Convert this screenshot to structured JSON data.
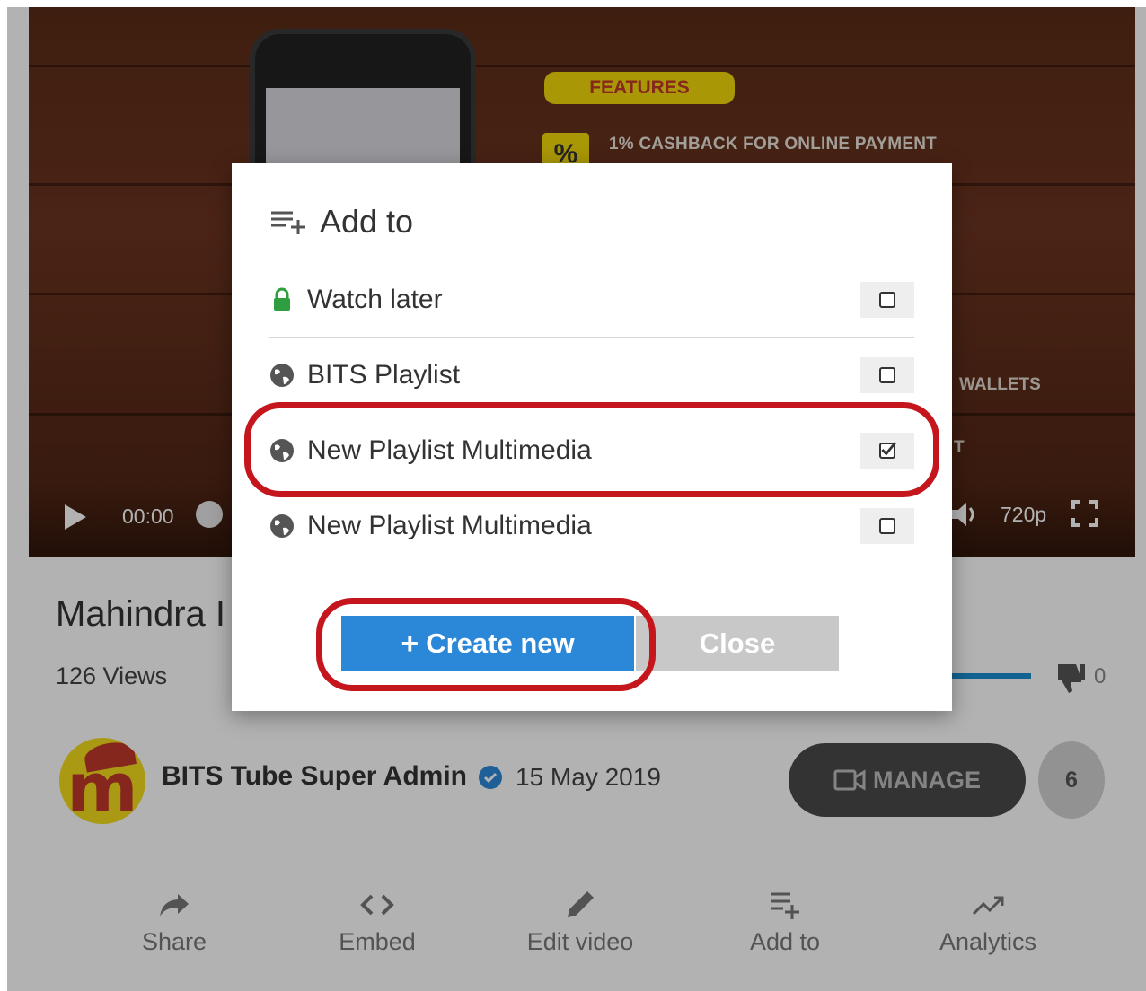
{
  "video": {
    "features_badge": "FEATURES",
    "percent_symbol": "%",
    "cashback_text": "1% CASHBACK FOR ONLINE PAYMENT",
    "wallets_text": "WALLETS",
    "partial_text": "T",
    "time": "00:00",
    "quality": "720p"
  },
  "info": {
    "title": "Mahindra I",
    "views": "126 Views",
    "dislike_count": "0",
    "avatar_letter": "m",
    "channel_name": "BITS Tube Super Admin",
    "upload_date": "15 May 2019",
    "manage_label": "MANAGE",
    "manage_count": "6"
  },
  "actions": [
    {
      "label": "Share",
      "icon": "share-icon"
    },
    {
      "label": "Embed",
      "icon": "embed-icon"
    },
    {
      "label": "Edit video",
      "icon": "pencil-icon"
    },
    {
      "label": "Add to",
      "icon": "playlist-add-icon"
    },
    {
      "label": "Analytics",
      "icon": "trending-up-icon"
    }
  ],
  "modal": {
    "title": "Add to",
    "playlists": [
      {
        "label": "Watch later",
        "icon": "lock-icon",
        "checked": false
      },
      {
        "label": "BITS Playlist",
        "icon": "globe-icon",
        "checked": false
      },
      {
        "label": "New Playlist Multimedia",
        "icon": "globe-icon",
        "checked": true
      },
      {
        "label": "New Playlist Multimedia",
        "icon": "globe-icon",
        "checked": false
      }
    ],
    "create_new_label": "Create new",
    "close_label": "Close"
  },
  "colors": {
    "primary_blue": "#2b88d8",
    "highlight_red": "#c4161c",
    "lock_green": "#2e9e3e",
    "verified_blue": "#2b88d8"
  }
}
